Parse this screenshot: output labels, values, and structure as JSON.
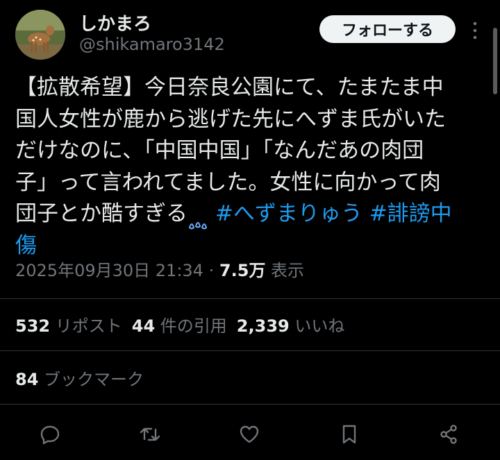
{
  "user": {
    "display_name": "しかまろ",
    "handle": "@shikamaro3142",
    "follow_label": "フォローする"
  },
  "tweet": {
    "lines": [
      {
        "text": "【拡散希望】今日奈良公園にて、たまたま中"
      },
      {
        "text": "国人女性が鹿から逃げた先にへずま氏がいた"
      },
      {
        "text": "だけなのに、「中国中国」「なんだあの肉団"
      },
      {
        "text": "子」って言われてました。女性に向かって肉"
      }
    ],
    "last_line_text": "団子とか酷すぎる",
    "hashtag1": "#へずまりゅう",
    "hashtag2_a": "#誹謗中",
    "hashtag2_b": "傷"
  },
  "meta": {
    "timestamp": "2025年09月30日 21:34",
    "separator": "·",
    "views": "7.5万",
    "views_label": "表示"
  },
  "stats": {
    "reposts": {
      "count": "532",
      "label": "リポスト"
    },
    "quotes": {
      "count": "44",
      "label": "件の引用"
    },
    "likes": {
      "count": "2,339",
      "label": "いいね"
    },
    "bookmarks": {
      "count": "84",
      "label": "ブックマーク"
    }
  },
  "colors": {
    "background": "#000000",
    "text": "#e7e9ea",
    "secondary": "#71767b",
    "link": "#1d9bf0",
    "divider": "#2f3336"
  },
  "icons": [
    "more-vertical-icon",
    "sweat-drops-icon",
    "reply-icon",
    "repost-icon",
    "like-icon",
    "bookmark-icon",
    "share-icon"
  ]
}
